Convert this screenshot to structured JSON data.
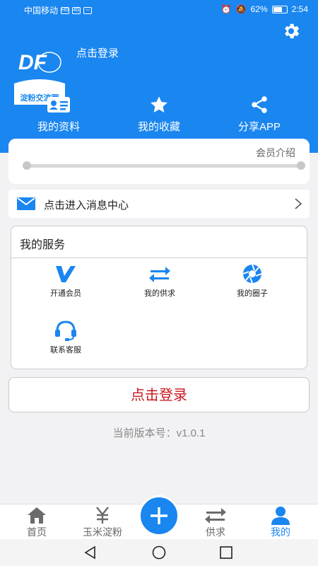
{
  "status_bar": {
    "carrier": "中国移动",
    "battery": "62%",
    "time": "2:54"
  },
  "header": {
    "logo_mark": "DF",
    "logo_text": "淀粉交流圈",
    "login_prompt": "点击登录",
    "quick_links": [
      {
        "label": "我的资料",
        "icon": "id-card-icon"
      },
      {
        "label": "我的收藏",
        "icon": "star-icon"
      },
      {
        "label": "分享APP",
        "icon": "share-icon"
      }
    ]
  },
  "member_card": {
    "intro_label": "会员介绍"
  },
  "message_bar": {
    "label": "点击进入消息中心"
  },
  "services": {
    "title": "我的服务",
    "items": [
      {
        "label": "开通会员",
        "icon": "v-member-icon"
      },
      {
        "label": "我的供求",
        "icon": "swap-arrows-icon"
      },
      {
        "label": "我的圈子",
        "icon": "aperture-icon"
      },
      {
        "label": "联系客服",
        "icon": "headset-icon"
      }
    ]
  },
  "login_button": "点击登录",
  "version": "当前版本号：v1.0.1",
  "tabbar": {
    "items": [
      {
        "label": "首页",
        "icon": "home-icon"
      },
      {
        "label": "玉米淀粉",
        "icon": "yuan-icon"
      },
      {
        "label": "",
        "icon": "plus-icon"
      },
      {
        "label": "供求",
        "icon": "swap-arrows-icon"
      },
      {
        "label": "我的",
        "icon": "user-icon"
      }
    ],
    "active_index": 4
  },
  "colors": {
    "primary": "#1a86f0",
    "login_red": "#c8161d",
    "background": "#f2f2f4"
  }
}
